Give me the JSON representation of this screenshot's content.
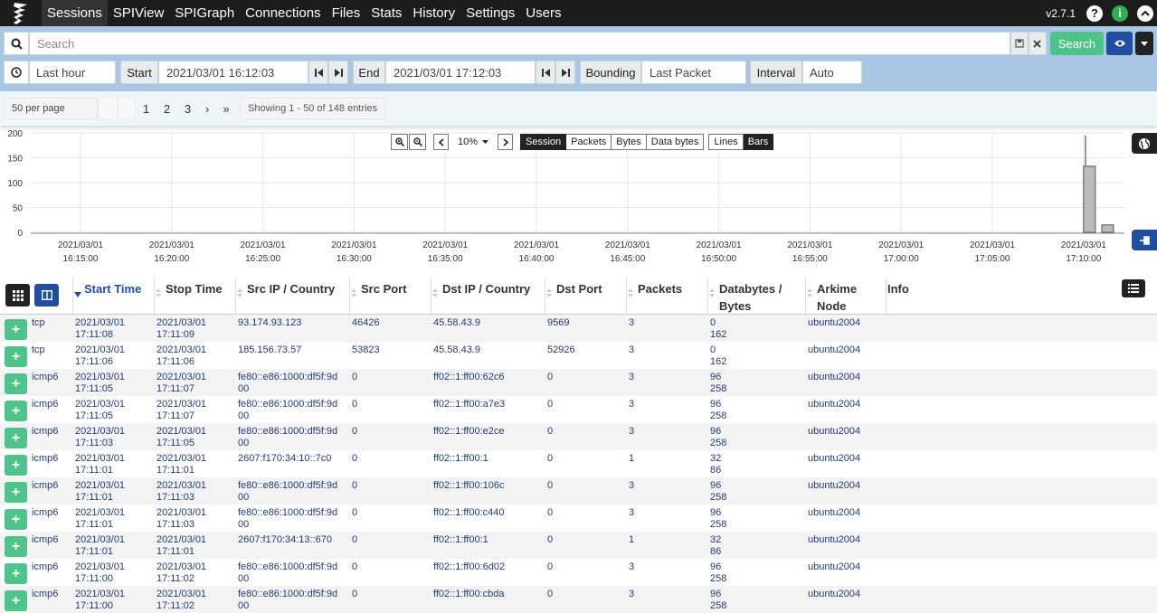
{
  "nav": {
    "items": [
      "Sessions",
      "SPIView",
      "SPIGraph",
      "Connections",
      "Files",
      "Stats",
      "History",
      "Settings",
      "Users"
    ],
    "version": "v2.7.1"
  },
  "search": {
    "placeholder": "Search",
    "search_button": "Search"
  },
  "time": {
    "range": "Last hour",
    "start_label": "Start",
    "start_value": "2021/03/01 16:12:03",
    "end_label": "End",
    "end_value": "2021/03/01 17:12:03",
    "bounding_label": "Bounding",
    "bounding_value": "Last Packet",
    "interval_label": "Interval",
    "interval_value": "Auto"
  },
  "paging": {
    "per_page": "50 per page",
    "pages": [
      "1",
      "2",
      "3"
    ],
    "next": "›",
    "last": "»",
    "showing": "Showing 1 - 50 of 148 entries"
  },
  "graph_controls": {
    "zoom": "10%",
    "metric_buttons": [
      "Session",
      "Packets",
      "Bytes",
      "Data bytes"
    ],
    "style_buttons": [
      "Lines",
      "Bars"
    ]
  },
  "chart_data": {
    "type": "bar",
    "y_ticks": [
      "200",
      "150",
      "100",
      "50",
      "0"
    ],
    "ylim": [
      0,
      200
    ],
    "x_ticks": [
      {
        "date": "2021/03/01",
        "time": "16:15:00"
      },
      {
        "date": "2021/03/01",
        "time": "16:20:00"
      },
      {
        "date": "2021/03/01",
        "time": "16:25:00"
      },
      {
        "date": "2021/03/01",
        "time": "16:30:00"
      },
      {
        "date": "2021/03/01",
        "time": "16:35:00"
      },
      {
        "date": "2021/03/01",
        "time": "16:40:00"
      },
      {
        "date": "2021/03/01",
        "time": "16:45:00"
      },
      {
        "date": "2021/03/01",
        "time": "16:50:00"
      },
      {
        "date": "2021/03/01",
        "time": "16:55:00"
      },
      {
        "date": "2021/03/01",
        "time": "17:00:00"
      },
      {
        "date": "2021/03/01",
        "time": "17:05:00"
      },
      {
        "date": "2021/03/01",
        "time": "17:10:00"
      }
    ],
    "bars": [
      {
        "x": "17:10:00",
        "value": 133
      },
      {
        "x": "17:11:00",
        "value": 15
      }
    ]
  },
  "table": {
    "headers": [
      "Start Time",
      "Stop Time",
      "Src IP / Country",
      "Src Port",
      "Dst IP / Country",
      "Dst Port",
      "Packets",
      "Databytes / Bytes",
      "Arkime Node",
      "Info"
    ],
    "rows": [
      {
        "proto": "tcp",
        "start": [
          "2021/03/01",
          "17:11:08"
        ],
        "stop": [
          "2021/03/01",
          "17:11:09"
        ],
        "src": [
          "93.174.93.123",
          ""
        ],
        "sport": "46426",
        "dst": "45.58.43.9",
        "dport": "9569",
        "packets": "3",
        "bytes": [
          "0",
          "162"
        ],
        "node": "ubuntu2004"
      },
      {
        "proto": "tcp",
        "start": [
          "2021/03/01",
          "17:11:06"
        ],
        "stop": [
          "2021/03/01",
          "17:11:06"
        ],
        "src": [
          "185.156.73.57",
          ""
        ],
        "sport": "53823",
        "dst": "45.58.43.9",
        "dport": "52926",
        "packets": "3",
        "bytes": [
          "0",
          "162"
        ],
        "node": "ubuntu2004"
      },
      {
        "proto": "icmp6",
        "start": [
          "2021/03/01",
          "17:11:05"
        ],
        "stop": [
          "2021/03/01",
          "17:11:07"
        ],
        "src": [
          "fe80::e86:1000:df5f:9d",
          "00"
        ],
        "sport": "0",
        "dst": "ff02::1:ff00:62c6",
        "dport": "0",
        "packets": "3",
        "bytes": [
          "96",
          "258"
        ],
        "node": "ubuntu2004"
      },
      {
        "proto": "icmp6",
        "start": [
          "2021/03/01",
          "17:11:05"
        ],
        "stop": [
          "2021/03/01",
          "17:11:07"
        ],
        "src": [
          "fe80::e86:1000:df5f:9d",
          "00"
        ],
        "sport": "0",
        "dst": "ff02::1:ff00:a7e3",
        "dport": "0",
        "packets": "3",
        "bytes": [
          "96",
          "258"
        ],
        "node": "ubuntu2004"
      },
      {
        "proto": "icmp6",
        "start": [
          "2021/03/01",
          "17:11:03"
        ],
        "stop": [
          "2021/03/01",
          "17:11:05"
        ],
        "src": [
          "fe80::e86:1000:df5f:9d",
          "00"
        ],
        "sport": "0",
        "dst": "ff02::1:ff00:e2ce",
        "dport": "0",
        "packets": "3",
        "bytes": [
          "96",
          "258"
        ],
        "node": "ubuntu2004"
      },
      {
        "proto": "icmp6",
        "start": [
          "2021/03/01",
          "17:11:01"
        ],
        "stop": [
          "2021/03/01",
          "17:11:01"
        ],
        "src": [
          "2607:f170:34:10::7c0",
          ""
        ],
        "sport": "0",
        "dst": "ff02::1:ff00:1",
        "dport": "0",
        "packets": "1",
        "bytes": [
          "32",
          "86"
        ],
        "node": "ubuntu2004"
      },
      {
        "proto": "icmp6",
        "start": [
          "2021/03/01",
          "17:11:01"
        ],
        "stop": [
          "2021/03/01",
          "17:11:03"
        ],
        "src": [
          "fe80::e86:1000:df5f:9d",
          "00"
        ],
        "sport": "0",
        "dst": "ff02::1:ff00:106c",
        "dport": "0",
        "packets": "3",
        "bytes": [
          "96",
          "258"
        ],
        "node": "ubuntu2004"
      },
      {
        "proto": "icmp6",
        "start": [
          "2021/03/01",
          "17:11:01"
        ],
        "stop": [
          "2021/03/01",
          "17:11:03"
        ],
        "src": [
          "fe80::e86:1000:df5f:9d",
          "00"
        ],
        "sport": "0",
        "dst": "ff02::1:ff00:c440",
        "dport": "0",
        "packets": "3",
        "bytes": [
          "96",
          "258"
        ],
        "node": "ubuntu2004"
      },
      {
        "proto": "icmp6",
        "start": [
          "2021/03/01",
          "17:11:01"
        ],
        "stop": [
          "2021/03/01",
          "17:11:01"
        ],
        "src": [
          "2607:f170:34:13::670",
          ""
        ],
        "sport": "0",
        "dst": "ff02::1:ff00:1",
        "dport": "0",
        "packets": "1",
        "bytes": [
          "32",
          "86"
        ],
        "node": "ubuntu2004"
      },
      {
        "proto": "icmp6",
        "start": [
          "2021/03/01",
          "17:11:00"
        ],
        "stop": [
          "2021/03/01",
          "17:11:02"
        ],
        "src": [
          "fe80::e86:1000:df5f:9d",
          "00"
        ],
        "sport": "0",
        "dst": "ff02::1:ff00:6d02",
        "dport": "0",
        "packets": "3",
        "bytes": [
          "96",
          "258"
        ],
        "node": "ubuntu2004"
      },
      {
        "proto": "icmp6",
        "start": [
          "2021/03/01",
          "17:11:00"
        ],
        "stop": [
          "2021/03/01",
          "17:11:02"
        ],
        "src": [
          "fe80::e86:1000:df5f:9d",
          "00"
        ],
        "sport": "0",
        "dst": "ff02::1:ff00:cbda",
        "dport": "0",
        "packets": "3",
        "bytes": [
          "96",
          "258"
        ],
        "node": "ubuntu2004"
      }
    ]
  },
  "colors": {
    "nav_bg": "#1c1c1c",
    "search_bg": "#a9c6e2",
    "accent_green": "#4ec48a",
    "primary_blue": "#1f4f9e",
    "link_text": "#203a7a"
  }
}
